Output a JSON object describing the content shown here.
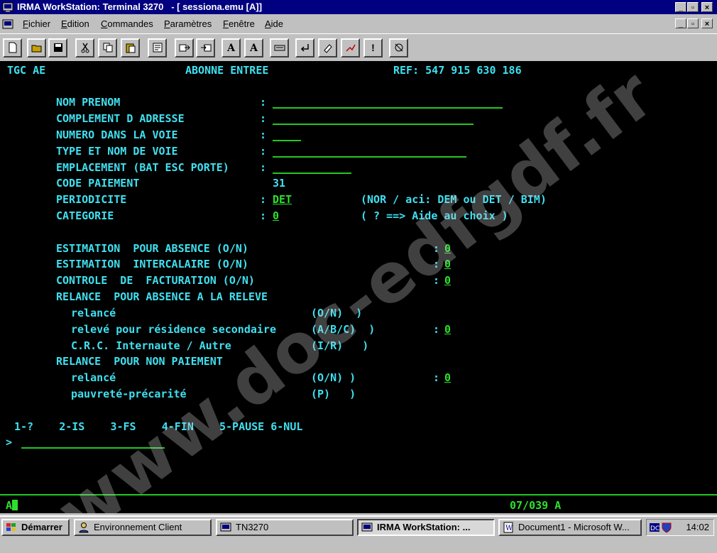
{
  "window": {
    "title": "IRMA WorkStation: Terminal 3270   - [ sessiona.emu [A]]"
  },
  "menu": [
    "Fichier",
    "Edition",
    "Commandes",
    "Paramètres",
    "Fenêtre",
    "Aide"
  ],
  "toolbar_buttons": [
    {
      "name": "new-icon"
    },
    {
      "name": "open-icon"
    },
    {
      "name": "save-icon"
    },
    {
      "name": "cut-icon"
    },
    {
      "name": "copy-icon"
    },
    {
      "name": "paste-icon"
    },
    {
      "name": "macro-icon"
    },
    {
      "name": "transfer-send-icon"
    },
    {
      "name": "transfer-receive-icon"
    },
    {
      "name": "font-size-icon"
    },
    {
      "name": "font-icon"
    },
    {
      "name": "keyboard-icon"
    },
    {
      "name": "return-icon"
    },
    {
      "name": "erase-icon"
    },
    {
      "name": "record-icon"
    },
    {
      "name": "attention-icon"
    },
    {
      "name": "hotspot-icon"
    }
  ],
  "terminal": {
    "header": {
      "left": "TGC AE",
      "center": "ABONNE ENTREE",
      "ref": "REF: 547 915 630 186"
    },
    "labels": {
      "nom_prenom": "NOM PRENOM",
      "complement": "COMPLEMENT D ADRESSE",
      "numero": "NUMERO DANS LA VOIE",
      "type_voie": "TYPE ET NOM DE VOIE",
      "emplacement": "EMPLACEMENT (BAT ESC PORTE)",
      "code_paiement": "CODE PAIEMENT",
      "periodicite": "PERIODICITE",
      "categorie": "CATEGORIE",
      "estimation_absence": "ESTIMATION  POUR ABSENCE (O/N)",
      "estimation_intercalaire": "ESTIMATION  INTERCALAIRE (O/N)",
      "controle": "CONTROLE  DE  FACTURATION (O/N)",
      "relance_absence": "RELANCE  POUR ABSENCE A LA RELEVE",
      "relance1": "relancé",
      "releve": "relevé pour résidence secondaire",
      "crc": "C.R.C. Internaute / Autre",
      "relance_paiement": "RELANCE  POUR NON PAIEMENT",
      "relance2": "relancé",
      "pauvrete": "pauvreté-précarité"
    },
    "colon": ":",
    "values": {
      "code_paiement": "31",
      "periodicite": "DET",
      "categorie": "0",
      "estimation_absence": "0",
      "estimation_intercalaire": "0",
      "controle": "0",
      "releve": "0",
      "relance2": "0"
    },
    "hints": {
      "periodicite": "(NOR / aci: DEM ou DET / BIM)",
      "categorie": "( ? ==> Aide au choix )",
      "relance1": "(O/N)  )",
      "releve": "(A/B/C)  )",
      "crc": "(I/R)   )",
      "relance2": "(O/N) )",
      "pauvrete": "(P)   )"
    },
    "function_keys": "1-?    2-IS    3-FS    4-FIN    5-PAUSE 6-NUL",
    "prompt": ">",
    "status": {
      "left": "A",
      "right": "07/039 A"
    }
  },
  "watermark": "www.doc-edfgdf.fr",
  "taskbar": {
    "start": "Démarrer",
    "tasks": [
      "Environnement Client",
      "TN3270",
      "IRMA WorkStation: ...",
      "Document1 - Microsoft W..."
    ],
    "clock": "14:02"
  }
}
